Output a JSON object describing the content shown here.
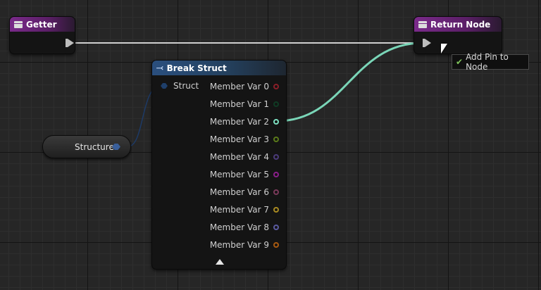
{
  "getter_node": {
    "title": "Getter"
  },
  "return_node": {
    "title": "Return Node"
  },
  "break_struct_node": {
    "title": "Break Struct",
    "input_pin": "Struct",
    "outputs": [
      {
        "label": "Member Var 0",
        "color": "#8a1f28"
      },
      {
        "label": "Member Var 1",
        "color": "#0f3b24"
      },
      {
        "label": "Member Var 2",
        "color": "#7de0c0"
      },
      {
        "label": "Member Var 3",
        "color": "#5a7a1a"
      },
      {
        "label": "Member Var 4",
        "color": "#4b3b7a"
      },
      {
        "label": "Member Var 5",
        "color": "#8a1f8a"
      },
      {
        "label": "Member Var 6",
        "color": "#7a3a5a"
      },
      {
        "label": "Member Var 7",
        "color": "#a88a22"
      },
      {
        "label": "Member Var 8",
        "color": "#5a5aa0"
      },
      {
        "label": "Member Var 9",
        "color": "#a85a10"
      }
    ]
  },
  "variable_node": {
    "label": "Structure"
  },
  "tooltip": {
    "text": "Add Pin to Node",
    "icon": "check-icon"
  },
  "colors": {
    "wire": "#7ad6b8",
    "exec_wire": "#cfcfcf",
    "struct_pin": "#3a5f9a"
  }
}
